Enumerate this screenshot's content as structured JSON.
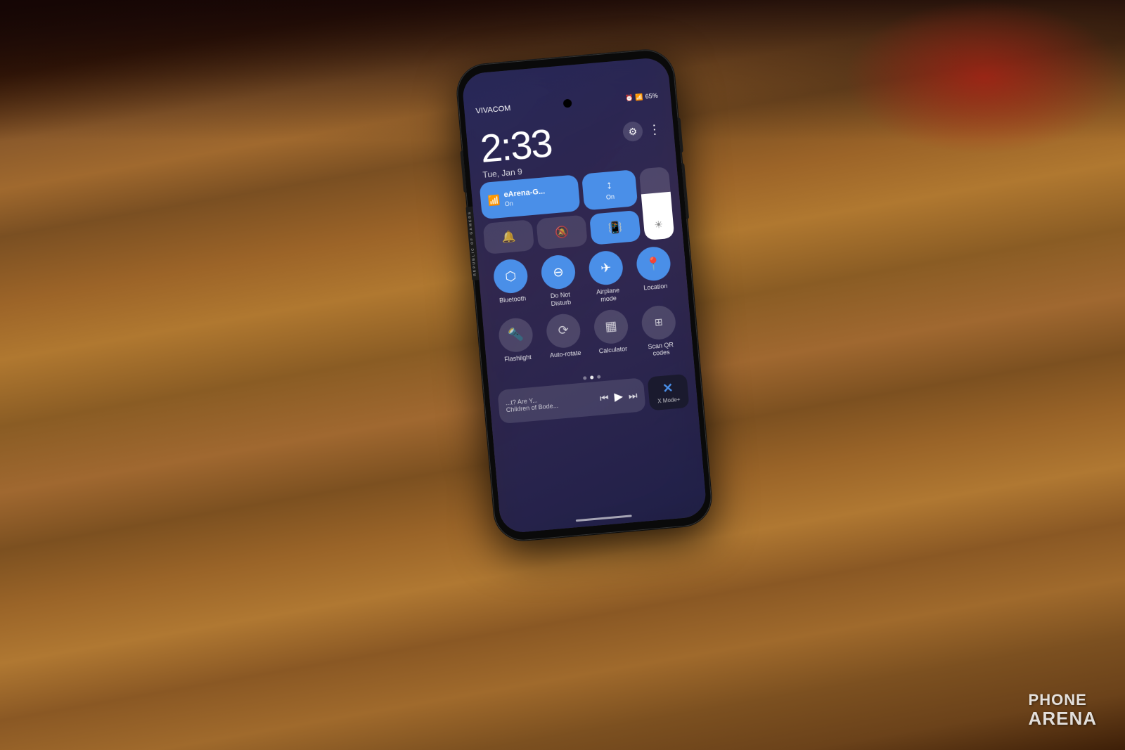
{
  "background": {
    "wood_color": "#8b5a2b"
  },
  "phone": {
    "status_bar": {
      "carrier": "VIVACOM",
      "time": "2:33",
      "date": "Tue, Jan 9",
      "battery": "65%"
    },
    "quick_settings": {
      "wifi_tile": {
        "label": "eArena-G...",
        "sub": "On"
      },
      "data_tile": {
        "label": "↕",
        "sub": "On"
      },
      "sound_tiles": {
        "bell_on": "🔔",
        "bell_off": "🔕",
        "vibrate": "📳"
      },
      "grid_items": [
        {
          "label": "Bluetooth",
          "icon": "⬡",
          "active": true
        },
        {
          "label": "Do Not Disturb",
          "icon": "⊖",
          "active": true
        },
        {
          "label": "Airplane mode",
          "icon": "✈",
          "active": true
        },
        {
          "label": "Location",
          "icon": "📍",
          "active": true
        },
        {
          "label": "Flashlight",
          "icon": "🔦",
          "active": false
        },
        {
          "label": "Auto-rotate",
          "icon": "⟳",
          "active": false
        },
        {
          "label": "Calculator",
          "icon": "▦",
          "active": false
        },
        {
          "label": "Scan QR codes",
          "icon": "⊞",
          "active": false
        }
      ]
    },
    "media": {
      "song_hint": "...t?  Are Y...",
      "artist": "Children of Bode...",
      "controls": [
        "⏮",
        "▶",
        "⏭"
      ]
    },
    "xmode": {
      "label": "X Mode+",
      "icon": "✕"
    }
  },
  "watermark": {
    "line1": "PHONE",
    "line2": "ARENA"
  }
}
